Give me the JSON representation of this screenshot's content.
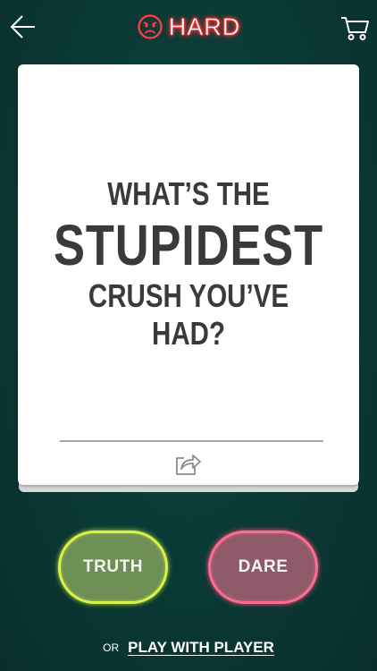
{
  "header": {
    "title": "HARD",
    "back_icon": "arrow-left-icon",
    "difficulty_icon": "angry-face-icon",
    "cart_icon": "shopping-cart-icon",
    "accent_color": "#ff3b3b"
  },
  "card": {
    "line1": "WHAT’S THE",
    "line2": "STUPIDEST",
    "line3": "CRUSH YOU’VE HAD?",
    "share_icon": "share-icon"
  },
  "choices": {
    "truth_label": "TRUTH",
    "dare_label": "DARE",
    "truth_color": "#6e8f55",
    "truth_glow": "#d9f24a",
    "dare_color": "#8e5a6a",
    "dare_glow": "#ff6c92"
  },
  "footer": {
    "or_label": "OR",
    "play_label": "PLAY WITH PLAYER"
  }
}
